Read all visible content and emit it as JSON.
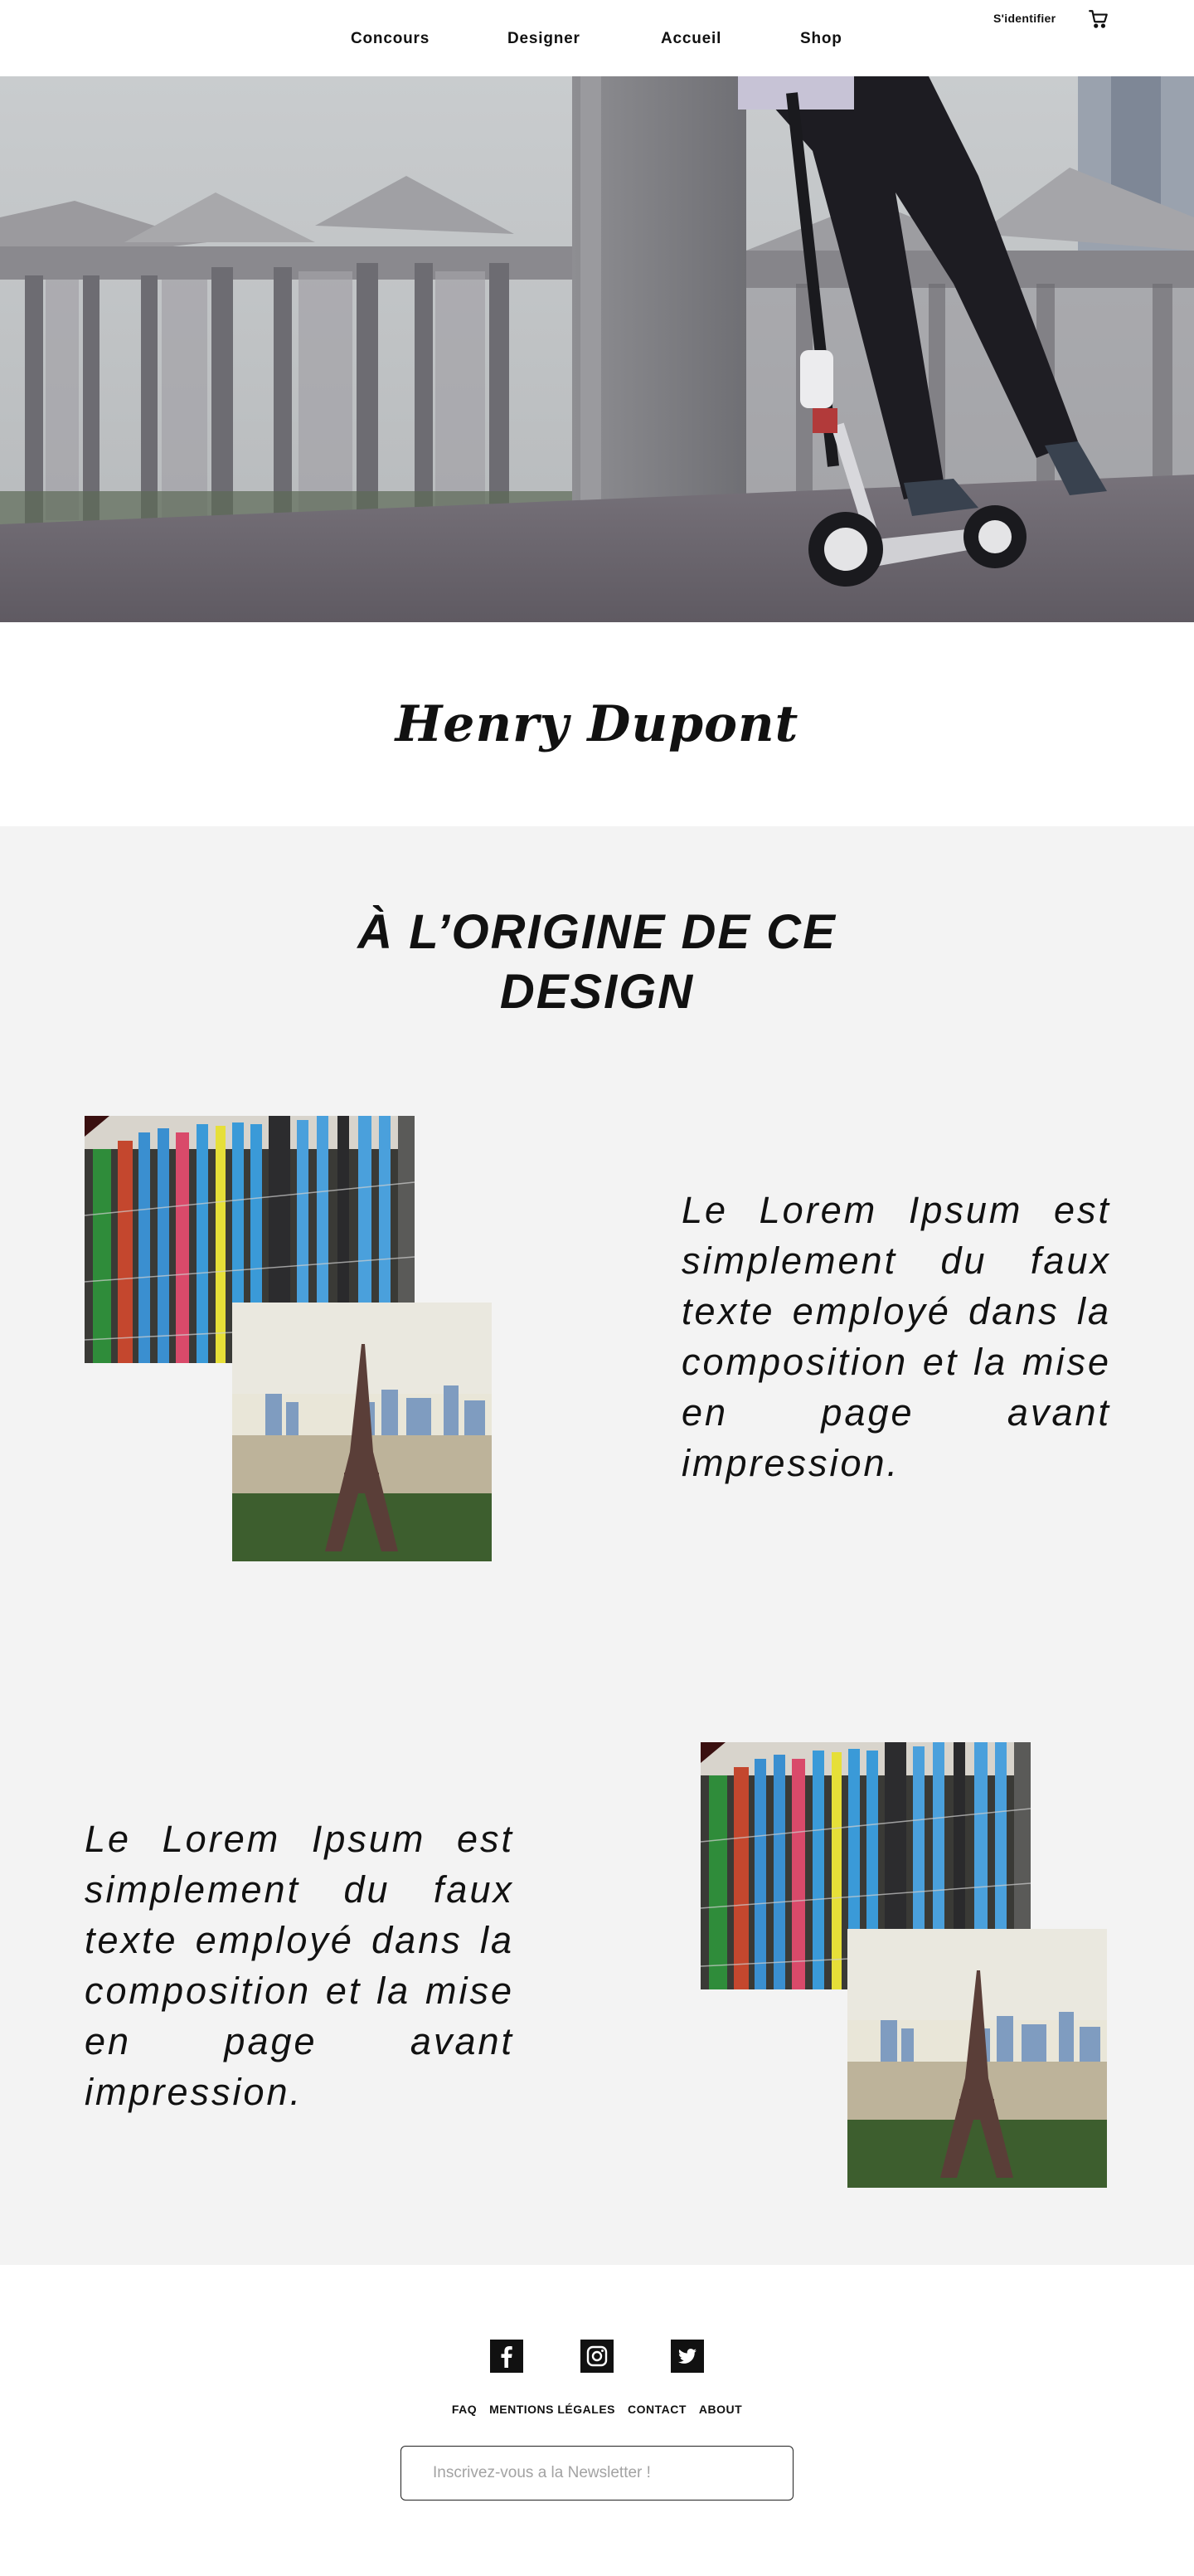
{
  "header": {
    "nav": [
      "Concours",
      "Designer",
      "Accueil",
      "Shop"
    ],
    "signin_label": "S'identifier",
    "cart_icon": "cart-icon"
  },
  "designer": {
    "name": "Henry Dupont"
  },
  "origin": {
    "title": "À L’ORIGINE DE CE DESIGN",
    "blocks": [
      {
        "text": "Le Lorem Ipsum est simplement du faux texte employé dans la composition et la mise en page avant impression."
      },
      {
        "text": "Le Lorem Ipsum est simplement du faux texte employé dans la composition et la mise en page avant impression."
      }
    ]
  },
  "footer": {
    "social_icons": [
      "facebook-icon",
      "instagram-icon",
      "twitter-icon"
    ],
    "links": [
      "FAQ",
      "MENTIONS LÉGALES",
      "CONTACT",
      "ABOUT"
    ],
    "newsletter_placeholder": "Inscrivez-vous a la Newsletter !"
  },
  "colors": {
    "section_bg": "#f3f3f3",
    "text": "#111111"
  }
}
